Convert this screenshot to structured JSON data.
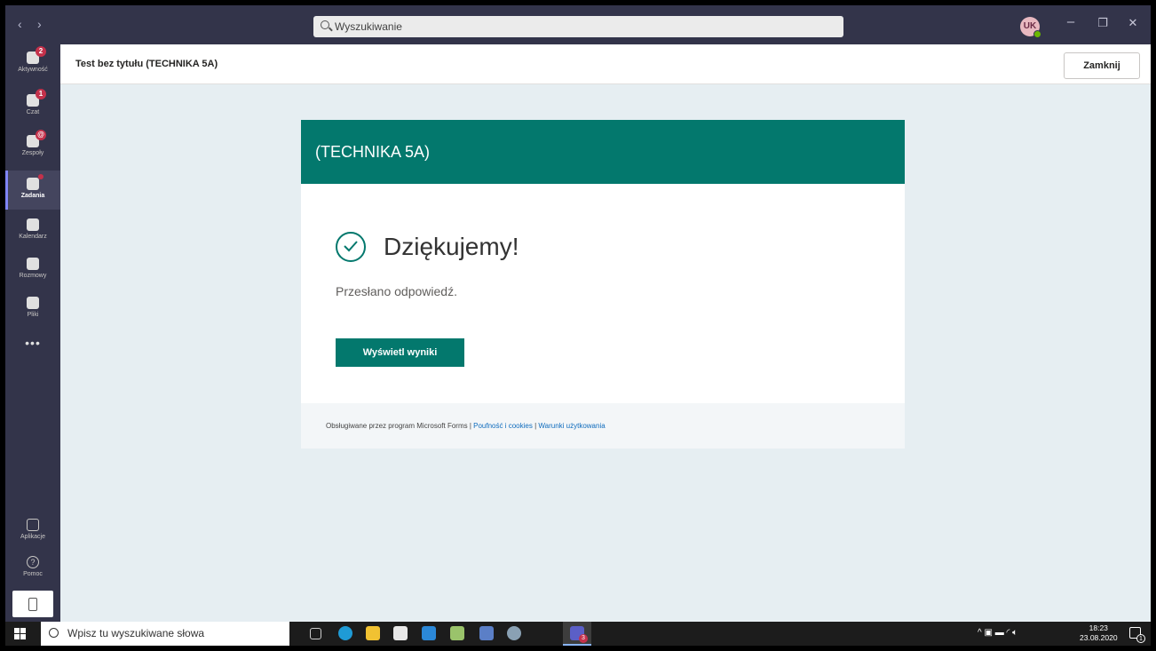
{
  "titlebar": {
    "back_glyph": "‹",
    "forward_glyph": "›",
    "search_placeholder": "Wyszukiwanie",
    "avatar_initials": "UK",
    "minimize_glyph": "–",
    "maximize_glyph": "❐",
    "close_glyph": "✕"
  },
  "rail": {
    "items": [
      {
        "label": "Aktywność",
        "icon": "bell-icon",
        "badge": "2"
      },
      {
        "label": "Czat",
        "icon": "chat-icon",
        "badge": "1"
      },
      {
        "label": "Zespoły",
        "icon": "teams-icon",
        "badge": "@"
      },
      {
        "label": "Zadania",
        "icon": "assignments-icon",
        "active": true
      },
      {
        "label": "Kalendarz",
        "icon": "calendar-icon"
      },
      {
        "label": "Rozmowy",
        "icon": "phone-icon"
      },
      {
        "label": "Pliki",
        "icon": "file-icon"
      }
    ],
    "more": "•••",
    "apps_label": "Aplikacje",
    "help_label": "Pomoc",
    "help_glyph": "?"
  },
  "header": {
    "title": "Test bez tytułu (TECHNIKA 5A)",
    "close_label": "Zamknij"
  },
  "form": {
    "header_title": "(TECHNIKA 5A)",
    "thanks": "Dziękujemy!",
    "submitted": "Przesłano odpowiedź.",
    "results_button": "Wyświetl wyniki",
    "footer_prefix": "Obsługiwane przez program Microsoft Forms |",
    "privacy_link": "Poufność i cookies",
    "separator": "|",
    "terms_link": "Warunki użytkowania"
  },
  "taskbar": {
    "search_placeholder": "Wpisz tu wyszukiwane słowa",
    "teams_badge": "3",
    "time": "18:23",
    "date": "23.08.2020",
    "notif_count": "1",
    "tray_glyphs": "^  ▣  ▬  ◜  🔈︎"
  },
  "colors": {
    "teams_dark": "#33344a",
    "forms_green": "#03786d",
    "content_bg": "#e6eef2"
  }
}
